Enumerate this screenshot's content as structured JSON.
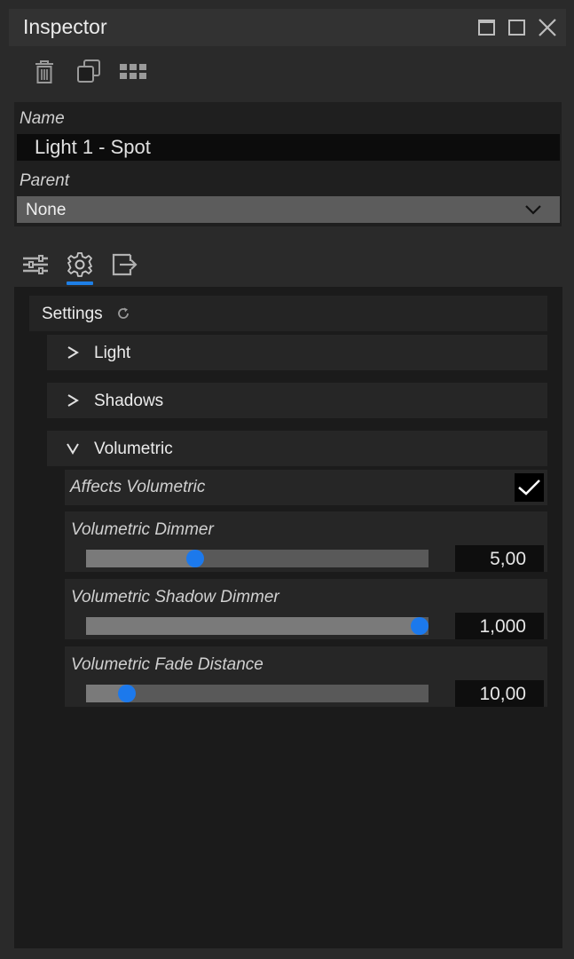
{
  "window": {
    "title": "Inspector"
  },
  "name_field": {
    "label": "Name",
    "value": "Light 1 - Spot"
  },
  "parent_field": {
    "label": "Parent",
    "selected": "None"
  },
  "settings": {
    "label": "Settings",
    "sections": [
      {
        "label": "Light",
        "expanded": false
      },
      {
        "label": "Shadows",
        "expanded": false
      },
      {
        "label": "Volumetric",
        "expanded": true
      }
    ],
    "volumetric": {
      "affects": {
        "label": "Affects Volumetric",
        "checked": true
      },
      "sliders": [
        {
          "label": "Volumetric Dimmer",
          "value": "5,00",
          "fraction": 0.31
        },
        {
          "label": "Volumetric Shadow Dimmer",
          "value": "1,000",
          "fraction": 1.0
        },
        {
          "label": "Volumetric Fade Distance",
          "value": "10,00",
          "fraction": 0.097
        }
      ]
    }
  },
  "colors": {
    "accent": "#1e7fe6",
    "slider_knob": "#1c79ec"
  }
}
